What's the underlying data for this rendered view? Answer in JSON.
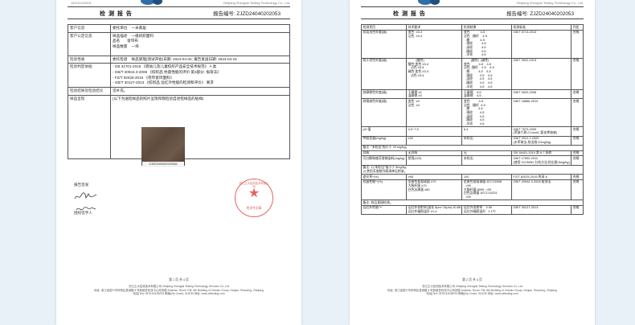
{
  "header": {
    "code": "161111242431",
    "corp": "Zhejiang Zhengda Testing Technology Co., Ltd.",
    "title": "检 测 报 告",
    "report_no": "报告编号: ZJZD24040202053"
  },
  "left": {
    "rows": [
      {
        "label": "客户信息",
        "pairs": [
          {
            "k": "委托单位",
            "v": "一米家居"
          }
        ]
      },
      {
        "label": "客户认定信息",
        "pairs": [
          {
            "k": "样品描述",
            "v": "一级机织面料"
          },
          {
            "k": "品名",
            "v": "窗帘布"
          },
          {
            "k": "样品数量",
            "v": "一块"
          }
        ]
      },
      {
        "label": "检验性质",
        "pairs": [
          {
            "k": "委托检测",
            "v": "样品受理(测试开始)日期: 2024-04-02;  报告发送日期: 2024-04-15"
          }
        ]
      },
      {
        "label": "检验判定依据",
        "lines": [
          "- GB 31701-2015 《婴幼儿及儿童纺织产品安全技术规范》 A 类",
          "- GB/T 20944.3-2008 《纺织品 抗菌性能的评价 第3部分: 振荡法》",
          "- FZ/T 62025-2015 《卷帘窗饰面料》",
          "- GB/T 30127-2013 《纺织品 远红外性能的检测和评价》 要求"
        ]
      },
      {
        "label": "检验结果及检验结论",
        "text": "见补充。"
      },
      {
        "label": "样品呈现",
        "text": "(以下为送检样品的照片呈现和我检验自述检样品的贴样)"
      }
    ],
    "photo_label": "ZJZD24040202053A",
    "sig_report": "报告签发",
    "sig_auth": "授权签字人",
    "stamp_text": "浙江正大检测技术有限公司",
    "stamp_sub": "检测专用章",
    "page_no": "第 1 页 共 4 页"
  },
  "right": {
    "col_heads": [
      "检测项目",
      "技术要求",
      "检测结果",
      "检测标准",
      "判定"
    ],
    "rows": [
      {
        "item": "耐皂洗色牢度(级)",
        "req": "变色  ≥3-4\n沾色  ≥3-4",
        "res": "变色            4-5\n沾色  -醋纤    4-5\n  -棉            4-5\n  -锦纶          4-5\n  -涤纶          4-5\n  -腈纶          4-5\n  -羊毛          4-5",
        "std": "GB/T 5713-2013",
        "judge": "合格"
      },
      {
        "item": "耐汗渍色牢度(级)",
        "req": "         (酸性)\n酸性:变色 ≥3-4\n   沾色 ≥3-4\n碱性:变色 ≥3-4\n   沾色 ≥3-4",
        "res": "        (酸性)  (碱性)\n变色          4-5    4-5\n沾色 -醋纤    4-5    4-5\n  -棉          4-5    4-5\n  -锦纶        4-5    4-5\n  -涤纶        4-5    4-5\n  -腈纶        4-5    4-5\n  -羊毛        4-5    4-5",
        "std": "GB/T 3922-2013",
        "judge": "合格"
      },
      {
        "item": "耐摩擦色牢度(级)",
        "req": "干摩擦 ≥4\n湿摩擦 ≥3",
        "res": "干摩擦    4-5\n湿摩擦    4-5",
        "std": "GB/T 3920-2008",
        "judge": "合格"
      },
      {
        "item": "耐唾液色牢度(级)",
        "req": "变色  ≥4\n沾色  ≥4",
        "res": "变色          4-5\n沾色  -醋纤  4-5\n  -棉          4-5\n  -锦纶        4-5\n  -涤纶        4-5\n  -腈纶        4-5\n  -羊毛        4-5",
        "std": "GB/T 18886-2019",
        "judge": "合格"
      },
      {
        "item": "pH 值",
        "req": "4.0~7.5",
        "res": "6.4",
        "std": "GB/T 7573-2009\n(萃取介质:0.1mol/L 氯化钾溶液)",
        "judge": "合格"
      },
      {
        "item": "甲醛含量(mg/kg)",
        "req": "≤20",
        "res": "未检出",
        "std": "GB/T 2912.1-2009\n(水萃取法,检出限:20mg/kg)",
        "judge": "合格"
      },
      {
        "item": "",
        "req": "备注: \"未检出\"指小于 20 mg/kg。",
        "res": "",
        "std": "",
        "judge": ""
      },
      {
        "item": "异味",
        "req": "无异味",
        "res": "无",
        "std": "GB 18401-2010 第 6.7 条款",
        "judge": "合格"
      },
      {
        "item": "可分解致癌芳香胺染料(mg/kg)",
        "req": "禁用(≤20)",
        "res": "未检出",
        "std": "GB/T 17592-2011\n(使用 GC/MSD 分析方法,检出限:5mg/kg)",
        "judge": "合格"
      },
      {
        "item": "",
        "req": "备注: 1)\"未检出\"指小于 5mg/kg;\n2) 禁用芳香胺列表清单见附录。",
        "res": "",
        "std": "",
        "judge": ""
      },
      {
        "item": "遮光率*(%)",
        "req": "≥95",
        "res": "100",
        "std": "FZ/T 62025-2015 附录 A",
        "judge": "合格"
      },
      {
        "item": "抗菌性能**(%)",
        "req": "金黄色葡萄球菌 ≥70\n大肠杆菌 ≥70\n白色念珠菌 ≥60",
        "res": "金黄色葡萄球菌 ATCC6538\n  >99\n大肠杆菌 8099  >99\n白色念珠菌 ATCC10231\n  >99",
        "std": "GB/T 20944.3-2008 振荡法",
        "judge": "合格"
      },
      {
        "item": "",
        "req": "备注: 样品直接检测。",
        "res": "",
        "std": "",
        "judge": ""
      },
      {
        "item": "远红外性能***",
        "req": "远红外发射率(波长 5μm~14μm) ≥0.88\n远红外辐照温升 ≥1.4",
        "res": "远红外发射率    0.90\n远红外辐照温升   2.1℃",
        "std": "GB/T 30127-2013",
        "judge": "合格"
      }
    ],
    "page_no": "第 2 页 共 4 页"
  },
  "footer": {
    "line1": "浙江正大检测技术有限公司 Zhejiang Zhengda Testing Technology Services Co.,Ltd",
    "line2": "地址: 浙江省嘉兴市柯桥区县城路 8 号新维多利亚中心商务楼 Address: Room 708, 8th Building of Xinmao Group, Keqiao, Shaoxing, Zhejiang",
    "line3": "电话(Tel): 0575-81108293   邮编(Zip Code): 312030   网址: www.zdtesting.com"
  }
}
